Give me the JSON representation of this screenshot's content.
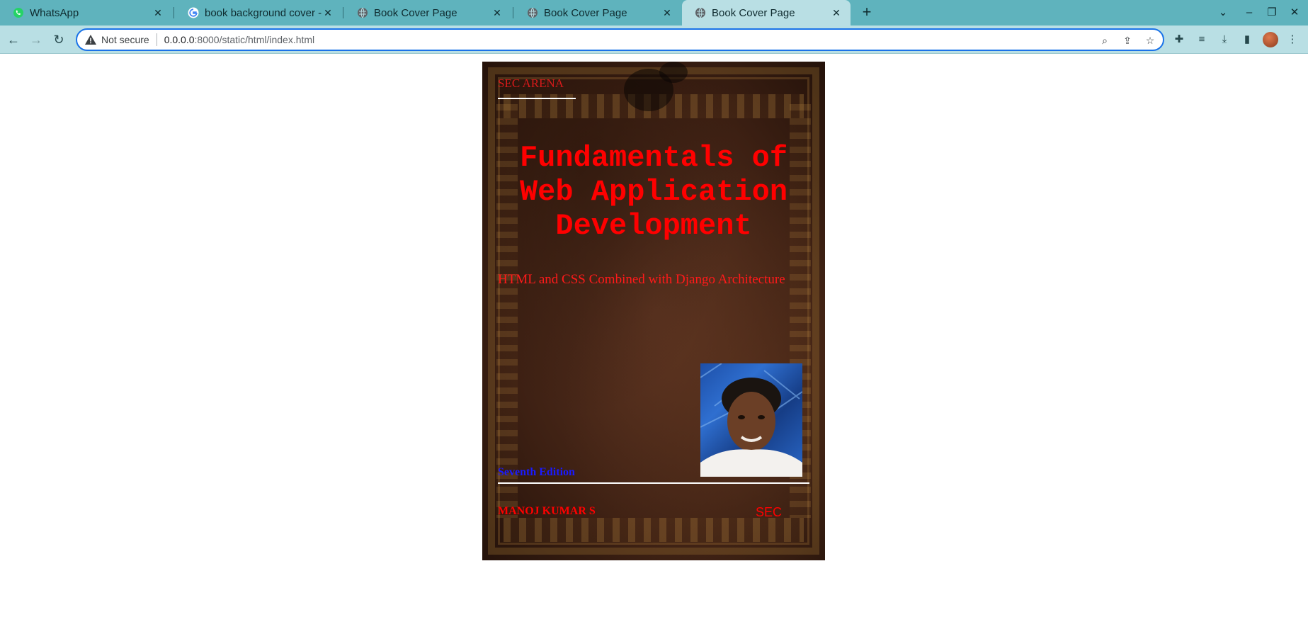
{
  "browser": {
    "tabs": [
      {
        "title": "WhatsApp",
        "icon": "whatsapp-icon",
        "active": false
      },
      {
        "title": "book background cover -",
        "icon": "google-icon",
        "active": false
      },
      {
        "title": "Book Cover Page",
        "icon": "globe-icon",
        "active": false
      },
      {
        "title": "Book Cover Page",
        "icon": "globe-icon",
        "active": false
      },
      {
        "title": "Book Cover Page",
        "icon": "globe-icon",
        "active": true
      }
    ],
    "address": {
      "security_label": "Not secure",
      "host": "0.0.0.0",
      "path": ":8000/static/html/index.html"
    },
    "accent_color": "#5fb3bd"
  },
  "book": {
    "publisher": "SEC ARENA",
    "title": "Fundamentals of Web Application Development",
    "subtitle": "HTML and CSS Combined with Django Architecture",
    "edition": "Seventh Edition",
    "author": "MANOJ KUMAR S",
    "imprint": "SEC",
    "colors": {
      "title": "#ff0000",
      "edition": "#1a1aff"
    }
  }
}
